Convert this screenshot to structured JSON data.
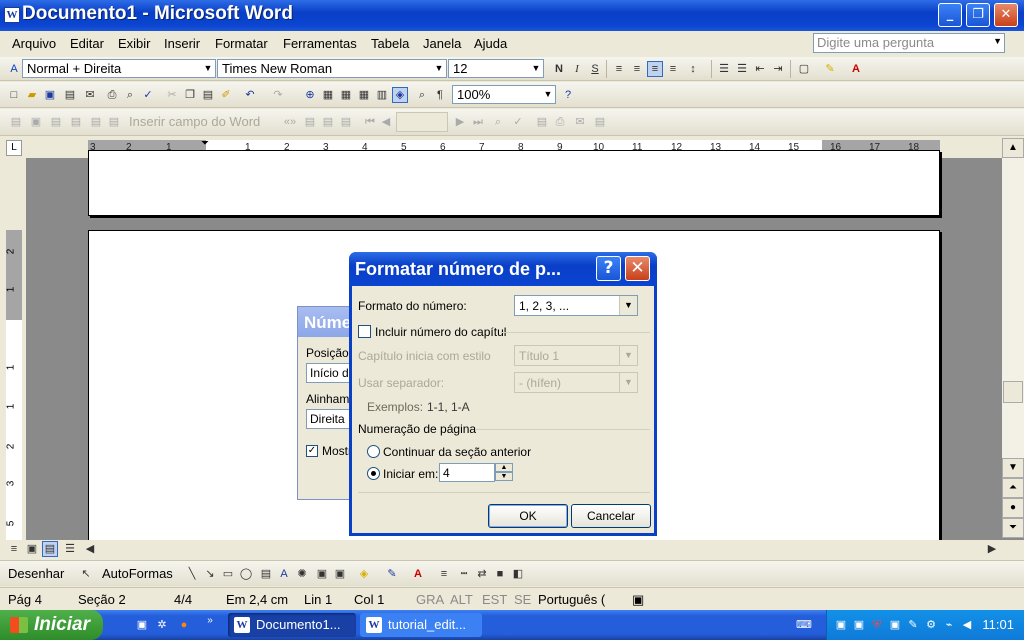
{
  "window": {
    "title": "Documento1 - Microsoft Word",
    "minimize": "_",
    "maximize": "❐",
    "close": "✕",
    "app_icon": "W"
  },
  "menu": [
    "Arquivo",
    "Editar",
    "Exibir",
    "Inserir",
    "Formatar",
    "Ferramentas",
    "Tabela",
    "Janela",
    "Ajuda"
  ],
  "ask_placeholder": "Digite uma pergunta",
  "formatting": {
    "style": "Normal + Direita",
    "font": "Times New Roman",
    "size": "12",
    "bold": "N",
    "italic": "I",
    "underline": "S"
  },
  "standard": {
    "zoom": "100%"
  },
  "mailmerge": {
    "insert_field": "Inserir campo do Word"
  },
  "ruler": {
    "tab_glyph": "L",
    "numbers": [
      "3",
      "2",
      "1",
      "1",
      "2",
      "3",
      "4",
      "5",
      "6",
      "7",
      "8",
      "9",
      "10",
      "11",
      "12",
      "13",
      "14",
      "15",
      "16",
      "17",
      "18"
    ]
  },
  "vruler": {
    "numbers": [
      "2",
      "1",
      "1",
      "1",
      "2",
      "3",
      "4",
      "5"
    ]
  },
  "back_dialog": {
    "title": "Núme",
    "position_label": "Posição:",
    "position_value": "Início da",
    "align_label": "Alinhame",
    "align_value": "Direita",
    "show_label": "Mostr"
  },
  "dialog": {
    "title": "Formatar número de p...",
    "help": "?",
    "close": "✕",
    "number_format_label": "Formato do número:",
    "number_format_value": "1, 2, 3, ...",
    "include_chapter": "Incluir número do capítul",
    "chapter_style_label": "Capítulo inicia com estilo",
    "chapter_style_value": "Título 1",
    "separator_label": "Usar separador:",
    "separator_value": "-   (hífen)",
    "examples_label": "Exemplos:",
    "examples_value": "1-1, 1-A",
    "page_numbering": "Numeração de página",
    "continue_label": "Continuar da seção anterior",
    "start_label": "Iniciar em:",
    "start_value": "4",
    "ok": "OK",
    "cancel": "Cancelar"
  },
  "drawing": {
    "draw": "Desenhar",
    "autoshapes": "AutoFormas"
  },
  "status": {
    "page": "Pág 4",
    "section": "Seção 2",
    "pages": "4/4",
    "at": "Em 2,4 cm",
    "line": "Lin 1",
    "col": "Col 1",
    "rec": "GRA",
    "trk": "ALT",
    "ext": "EST",
    "ovr": "SE",
    "language": "Português ("
  },
  "taskbar": {
    "start": "Iniciar",
    "tasks": [
      "Documento1...",
      "tutorial_edit..."
    ],
    "clock": "11:01",
    "task_icon": "W"
  }
}
